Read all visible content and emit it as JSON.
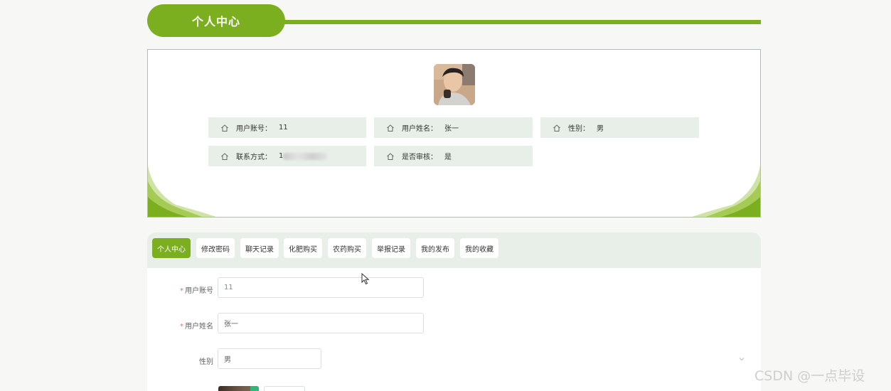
{
  "header": {
    "title": "个人中心"
  },
  "profile": {
    "fields": [
      {
        "label": "用户账号：",
        "value": "11"
      },
      {
        "label": "用户姓名：",
        "value": "张一"
      },
      {
        "label": "性别：",
        "value": "男"
      },
      {
        "label": "联系方式：",
        "value": "1"
      },
      {
        "label": "是否审核：",
        "value": "是"
      }
    ]
  },
  "tabs": [
    {
      "label": "个人中心",
      "active": true
    },
    {
      "label": "修改密码",
      "active": false
    },
    {
      "label": "聊天记录",
      "active": false
    },
    {
      "label": "化肥购买",
      "active": false
    },
    {
      "label": "农药购买",
      "active": false
    },
    {
      "label": "举报记录",
      "active": false
    },
    {
      "label": "我的发布",
      "active": false
    },
    {
      "label": "我的收藏",
      "active": false
    }
  ],
  "form": {
    "required_mark": "*",
    "account_label": "用户账号",
    "account_value": "11",
    "name_label": "用户姓名",
    "name_value": "张一",
    "gender_label": "性别",
    "gender_value": "男"
  },
  "watermark": "CSDN @一点毕设",
  "colors": {
    "accent": "#7caf1f",
    "panel": "#e8efe8",
    "required": "#f56c6c"
  },
  "icons": [
    "home-icon",
    "chevron-down-icon",
    "mouse-pointer-icon",
    "check-icon"
  ]
}
